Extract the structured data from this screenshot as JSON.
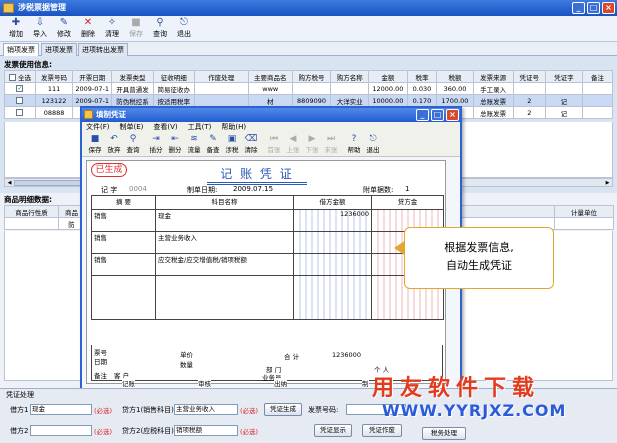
{
  "window": {
    "title": "涉税票据管理"
  },
  "toolbar": [
    {
      "label": "增加",
      "icon": "add-icon",
      "enabled": true
    },
    {
      "label": "导入",
      "icon": "import-icon",
      "enabled": true
    },
    {
      "label": "修改",
      "icon": "edit-icon",
      "enabled": true
    },
    {
      "label": "删除",
      "icon": "delete-icon",
      "enabled": true
    },
    {
      "label": "清理",
      "icon": "clean-icon",
      "enabled": true
    },
    {
      "label": "保存",
      "icon": "save-icon",
      "enabled": false
    },
    {
      "label": "查询",
      "icon": "search-icon",
      "enabled": true
    },
    {
      "label": "退出",
      "icon": "exit-icon",
      "enabled": true
    }
  ],
  "tabs": [
    "销项发票",
    "进项发票",
    "进项转出发票"
  ],
  "invoice_section": {
    "title": "发票使用信息:"
  },
  "invoice_table": {
    "headers": [
      "全选",
      "发票号码",
      "开票日期",
      "发票类型",
      "征收明细",
      "作废处理",
      "主要商品名",
      "购方税号",
      "购方名称",
      "金额",
      "税率",
      "税额",
      "发票来源",
      "凭证号",
      "凭证字",
      "备注"
    ],
    "rows": [
      {
        "checked": true,
        "cells": [
          "",
          "111",
          "2009-07-1",
          "开具普通发",
          "简易征收办",
          "",
          "www",
          "",
          "",
          "12000.00",
          "0.030",
          "360.00",
          "手工录入",
          "",
          "",
          ""
        ]
      },
      {
        "checked": false,
        "cells": [
          "",
          "123122",
          "2009-07-1",
          "防伪税控系",
          "按适用税率",
          "",
          "材",
          "8809090",
          "大洋实业",
          "10000.00",
          "0.170",
          "1700.00",
          "总账发票",
          "2",
          "记",
          ""
        ]
      },
      {
        "checked": false,
        "cells": [
          "",
          "08888",
          "",
          "",
          "",
          "",
          "",
          "",
          "",
          "",
          "",
          "",
          "总账发票",
          "2",
          "记",
          ""
        ]
      }
    ]
  },
  "goods_section": {
    "title": "商品明细数据:"
  },
  "goods_table": {
    "headers": [
      "商品行性质",
      "商品",
      "计量单位"
    ],
    "cell": "防"
  },
  "dialog": {
    "title": "填制凭证",
    "menu": [
      "文件(F)",
      "制单(E)",
      "查看(V)",
      "工具(T)",
      "帮助(H)"
    ],
    "toolbar": [
      {
        "label": "保存",
        "icon": "save-icon",
        "enabled": true
      },
      {
        "label": "放弃",
        "icon": "undo-icon",
        "enabled": true
      },
      {
        "label": "查询",
        "icon": "search-icon",
        "enabled": true
      },
      {
        "label": "插分",
        "icon": "insert-icon",
        "enabled": true
      },
      {
        "label": "删分",
        "icon": "remove-icon",
        "enabled": true
      },
      {
        "label": "流量",
        "icon": "flow-icon",
        "enabled": true
      },
      {
        "label": "备查",
        "icon": "memo-icon",
        "enabled": true
      },
      {
        "label": "涉税",
        "icon": "tax-icon",
        "enabled": true
      },
      {
        "label": "清除",
        "icon": "clear-icon",
        "enabled": true
      },
      {
        "label": "首张",
        "icon": "first-icon",
        "enabled": false
      },
      {
        "label": "上张",
        "icon": "prev-icon",
        "enabled": false
      },
      {
        "label": "下张",
        "icon": "next-icon",
        "enabled": false
      },
      {
        "label": "末张",
        "icon": "last-icon",
        "enabled": false
      },
      {
        "label": "帮助",
        "icon": "help-icon",
        "enabled": true
      },
      {
        "label": "退出",
        "icon": "exit-icon",
        "enabled": true
      }
    ],
    "status": "已生成",
    "voucher_title": "记 账 凭 证",
    "voucher_word": "记 字",
    "voucher_no": "0004",
    "date_label": "制单日期:",
    "date": "2009.07.15",
    "attach_label": "附单据数:",
    "attach_count": "1",
    "col_summary": "摘 要",
    "col_account": "科目名称",
    "col_debit": "借方金额",
    "col_credit": "贷方金",
    "lines": [
      {
        "summary": "销售",
        "account": "现金",
        "debit": "1236000",
        "credit": ""
      },
      {
        "summary": "销售",
        "account": "主营业务收入",
        "debit": "",
        "credit": ""
      },
      {
        "summary": "销售",
        "account": "应交税金/应交增值税/销项税额",
        "debit": "",
        "credit": ""
      }
    ],
    "footer": {
      "ticket_no": "票号",
      "ticket_date": "日期",
      "unit_price": "单价",
      "quantity": "数量",
      "total": "合 计",
      "total_debit": "1236000",
      "note": "备注",
      "project": "项 目",
      "customer": "客 户",
      "department": "部 门",
      "person": "个 人",
      "salesman": "业务员",
      "bookkeeper": "记账",
      "auditor": "审核",
      "cashier": "出纳",
      "maker": "制"
    }
  },
  "callout": {
    "line1": "根据发票信息,",
    "line2": "自动生成凭证"
  },
  "bottom": {
    "section_title": "凭证处理",
    "debit1_label": "借方1",
    "debit1_value": "现金",
    "credit1_label": "贷方1(销售科目)",
    "credit1_value": "主营业务收入",
    "debit2_label": "借方2",
    "credit2_label": "贷方2(应税科目)",
    "credit2_value": "销项税额",
    "required": "(必选)",
    "invoice_no_label": "发票号码:",
    "btn_generate": "凭证生成",
    "btn_show": "凭证显示",
    "btn_void": "凭证作废",
    "btn_tax": "税务处理"
  },
  "watermark": {
    "brand": "用友软件下载",
    "url": "WWW.YYRJXZ.COM"
  }
}
